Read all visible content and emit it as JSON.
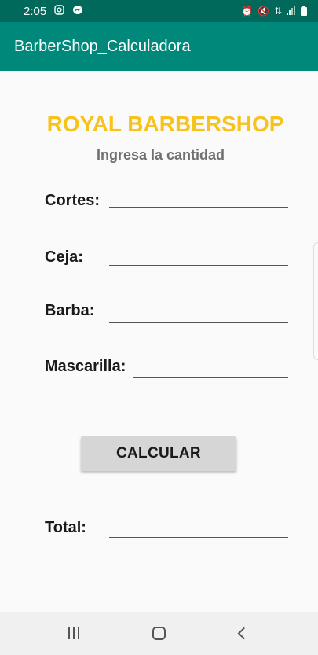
{
  "status_bar": {
    "time": "2:05",
    "left_icons": [
      "instagram-icon",
      "messenger-icon"
    ],
    "right_icons": [
      "alarm-icon",
      "mute-icon",
      "data-icon",
      "signal-icon",
      "battery-icon"
    ]
  },
  "app_bar": {
    "title": "BarberShop_Calculadora"
  },
  "main": {
    "shop_title": "ROYAL BARBERSHOP",
    "subtitle": "Ingresa la cantidad",
    "fields": [
      {
        "label": "Cortes:",
        "value": ""
      },
      {
        "label": "Ceja:",
        "value": ""
      },
      {
        "label": "Barba:",
        "value": ""
      },
      {
        "label": "Mascarilla:",
        "value": ""
      }
    ],
    "calculate_label": "CALCULAR",
    "total_label": "Total:",
    "total_value": ""
  },
  "colors": {
    "status_bar": "#00695c",
    "app_bar": "#00897b",
    "title_accent": "#f8c21c",
    "button": "#d6d6d6"
  },
  "nav_bar": {
    "buttons": [
      "recents-icon",
      "home-icon",
      "back-icon"
    ]
  }
}
